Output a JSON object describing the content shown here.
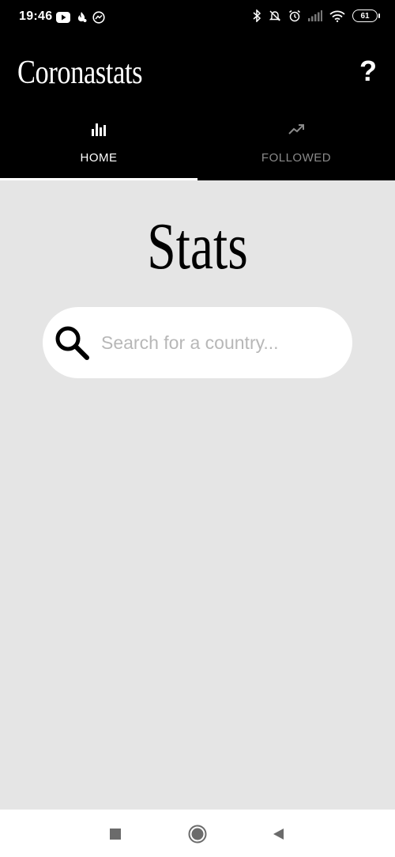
{
  "status_bar": {
    "time": "19:46",
    "left_icons": [
      "youtube-icon",
      "fire-icon",
      "messenger-icon"
    ],
    "right_icons": [
      "bluetooth-icon",
      "notifications-off-icon",
      "alarm-icon",
      "signal-icon",
      "wifi-icon"
    ],
    "battery_level": "61"
  },
  "app_bar": {
    "title": "Coronastats",
    "help_label": "?"
  },
  "tabs": [
    {
      "label": "HOME",
      "icon": "bar-chart-icon",
      "active": true
    },
    {
      "label": "FOLLOWED",
      "icon": "trending-up-icon",
      "active": false
    }
  ],
  "main": {
    "title": "Stats",
    "search": {
      "placeholder": "Search for a country...",
      "value": ""
    }
  },
  "nav_bar": {
    "buttons": [
      "recents-square-icon",
      "home-circle-icon",
      "back-triangle-icon"
    ]
  },
  "colors": {
    "app_bar_bg": "#000000",
    "page_bg": "#e5e5e5",
    "active_tab": "#ffffff",
    "inactive_tab": "#8a8a8a",
    "placeholder": "#b7b7b7"
  }
}
